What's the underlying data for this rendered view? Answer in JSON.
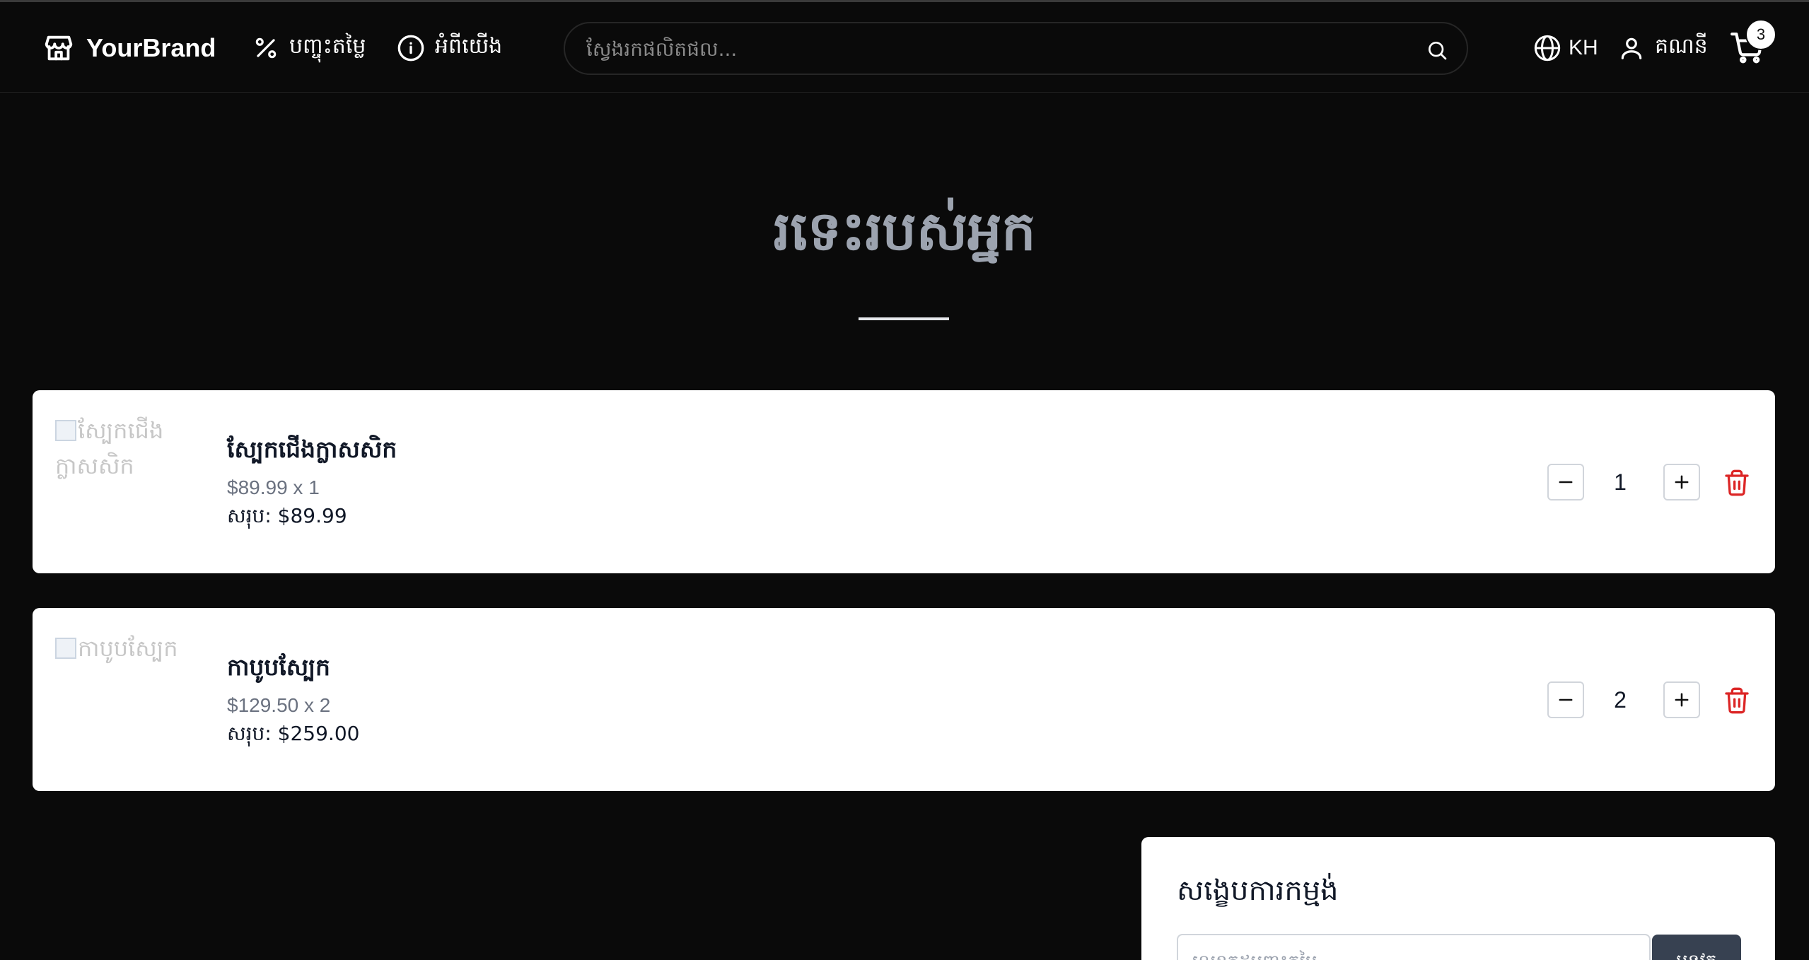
{
  "header": {
    "brand": "YourBrand",
    "nav": [
      {
        "label": "បញ្ចុះតម្លៃ",
        "icon": "percent-icon"
      },
      {
        "label": "អំពីយើង",
        "icon": "info-icon"
      }
    ],
    "search": {
      "placeholder": "ស្វែងរកផលិតផល..."
    },
    "language": "KH",
    "account_label": "គណនី",
    "cart_count": "3"
  },
  "page": {
    "title": "រទេះរបស់អ្នក"
  },
  "cart": {
    "items": [
      {
        "image_alt": "ស្បែកជើងក្លាសសិក",
        "name": "ស្បែកជើងក្លាសសិក",
        "price_line": "$89.99 x 1",
        "subtotal_label": "សរុប: ",
        "subtotal": "$89.99",
        "quantity": "1"
      },
      {
        "image_alt": "កាបូបស្បែក",
        "name": "កាបូបស្បែក",
        "price_line": "$129.50 x 2",
        "subtotal_label": "សរុប: ",
        "subtotal": "$259.00",
        "quantity": "2"
      }
    ]
  },
  "summary": {
    "title": "សង្ខេបការកម្មង់",
    "coupon_placeholder": "លេខកូដបញ្ចុះតម្លៃ",
    "apply_label": "អនុវត្ត"
  },
  "colors": {
    "background": "#0a0a0a",
    "card": "#ffffff",
    "delete": "#dc2626",
    "title": "#9ca3af"
  }
}
